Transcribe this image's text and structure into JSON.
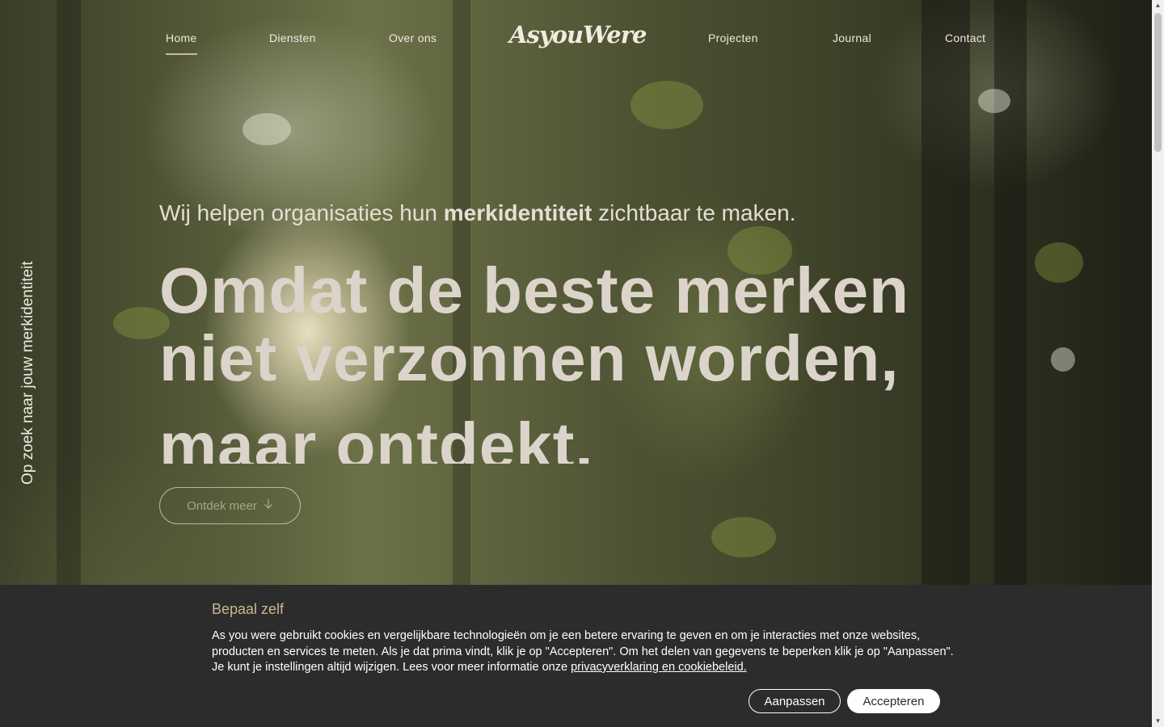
{
  "nav": {
    "items": [
      {
        "label": "Home",
        "active": true
      },
      {
        "label": "Diensten"
      },
      {
        "label": "Over ons"
      },
      {
        "label": "Projecten"
      },
      {
        "label": "Journal"
      },
      {
        "label": "Contact"
      }
    ],
    "logo": "AsyouWere"
  },
  "hero": {
    "side_text": "Op zoek naar jouw merkidentiteit",
    "intro_before": "Wij helpen organisaties hun ",
    "intro_bold": "merkidentiteit",
    "intro_after": " zichtbaar te maken.",
    "headline": [
      "Omdat de beste merken",
      "niet verzonnen worden,",
      "maar ontdekt."
    ],
    "cta_label": "Ontdek meer",
    "cta_icon": "arrow-down-icon"
  },
  "cookie": {
    "title": "Bepaal zelf",
    "text": "As you were gebruikt cookies en vergelijkbare technologieën om je een betere ervaring te geven en om je interacties met onze websites, producten en services te meten. Als je dat prima vindt, klik je op \"Accepteren\". Om het delen van gegevens te beperken klik je op \"Aanpassen\". Je kunt je instellingen altijd wijzigen. Lees voor meer informatie onze ",
    "link": "privacyverklaring en cookiebeleid.",
    "customize_label": "Aanpassen",
    "accept_label": "Accepteren"
  },
  "colors": {
    "accent": "#c9b890",
    "banner_bg": "#2c2c2c",
    "text_light": "#f1ebe0"
  }
}
